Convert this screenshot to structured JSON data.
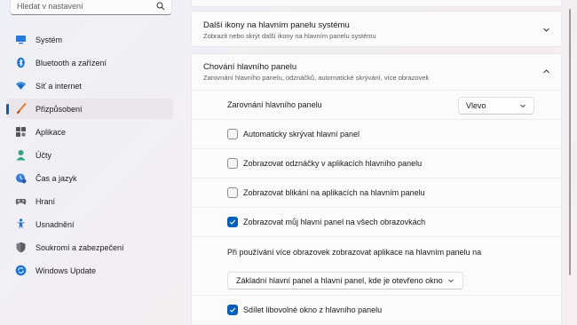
{
  "search": {
    "placeholder": "Hledat v nastavení"
  },
  "sidebar": {
    "items": [
      {
        "label": "Systém",
        "icon": "system-icon",
        "active": false
      },
      {
        "label": "Bluetooth a zařízení",
        "icon": "bluetooth-icon",
        "active": false
      },
      {
        "label": "Síť a internet",
        "icon": "network-icon",
        "active": false
      },
      {
        "label": "Přizpůsobení",
        "icon": "brush-icon",
        "active": true
      },
      {
        "label": "Aplikace",
        "icon": "apps-icon",
        "active": false
      },
      {
        "label": "Účty",
        "icon": "accounts-icon",
        "active": false
      },
      {
        "label": "Čas a jazyk",
        "icon": "time-language-icon",
        "active": false
      },
      {
        "label": "Hraní",
        "icon": "gaming-icon",
        "active": false
      },
      {
        "label": "Usnadnění",
        "icon": "accessibility-icon",
        "active": false
      },
      {
        "label": "Soukromí a zabezpečení",
        "icon": "shield-icon",
        "active": false
      },
      {
        "label": "Windows Update",
        "icon": "update-icon",
        "active": false
      }
    ]
  },
  "ikony": {
    "title": "Další ikony na hlavním panelu systému",
    "subtitle": "Zobrazit nebo skrýt další ikony na hlavním panelu systému"
  },
  "chovani": {
    "title": "Chování hlavního panelu",
    "subtitle": "Zarovnání hlavního panelu, odznáčků, automatické skrývání, více obrazovek",
    "alignment_label": "Zarovnání hlavního panelu",
    "alignment_value": "Vlevo",
    "options": [
      {
        "label": "Automaticky skrývat hlavní panel",
        "checked": false
      },
      {
        "label": "Zobrazovat odznáčky v aplikacích hlavního panelu",
        "checked": false
      },
      {
        "label": "Zobrazovat blikání na aplikacích na hlavním panelu",
        "checked": false
      },
      {
        "label": "Zobrazovat můj hlavní panel na všech obrazovkách",
        "checked": true
      }
    ],
    "multi_label": "Při používání více obrazovek zobrazovat aplikace na hlavním panelu na",
    "multi_value": "Základní hlavní panel a hlavní panel, kde je otevřeno okno",
    "share_label": "Sdílet libovolné okno z hlavního panelu",
    "share_checked": true
  },
  "colors": {
    "accent": "#005fb8"
  }
}
